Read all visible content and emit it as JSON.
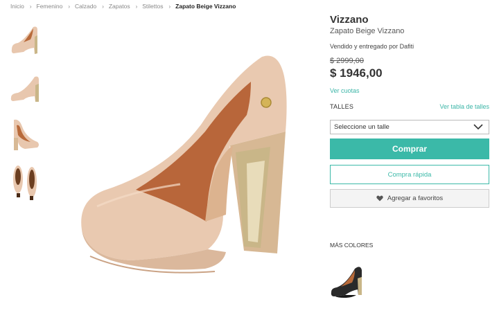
{
  "breadcrumb": {
    "items": [
      "Inicio",
      "Femenino",
      "Calzado",
      "Zapatos",
      "Stilettos"
    ],
    "current": "Zapato Beige Vizzano",
    "separator": "›"
  },
  "thumbnails": [
    "shoe-side-view",
    "shoe-profile-view",
    "shoe-back-view",
    "shoe-soles-view"
  ],
  "product": {
    "brand": "Vizzano",
    "name": "Zapato Beige Vizzano",
    "seller": "Vendido y entregado por Dafiti",
    "old_price": "$ 2999,00",
    "price": "$ 1946,00",
    "installments_link": "Ver cuotas"
  },
  "sizes": {
    "label": "TALLES",
    "chart_link": "Ver tabla de talles",
    "select_placeholder": "Seleccione un talle"
  },
  "buttons": {
    "buy": "Comprar",
    "quick_buy": "Compra rápida",
    "favorites": "Agregar a favoritos"
  },
  "more_colors": {
    "label": "MÁS COLORES",
    "swatches": [
      "black"
    ]
  },
  "colors": {
    "accent": "#3bb9a8",
    "shoe_beige": "#e8c7ae",
    "heel_gold": "#c9b688"
  }
}
